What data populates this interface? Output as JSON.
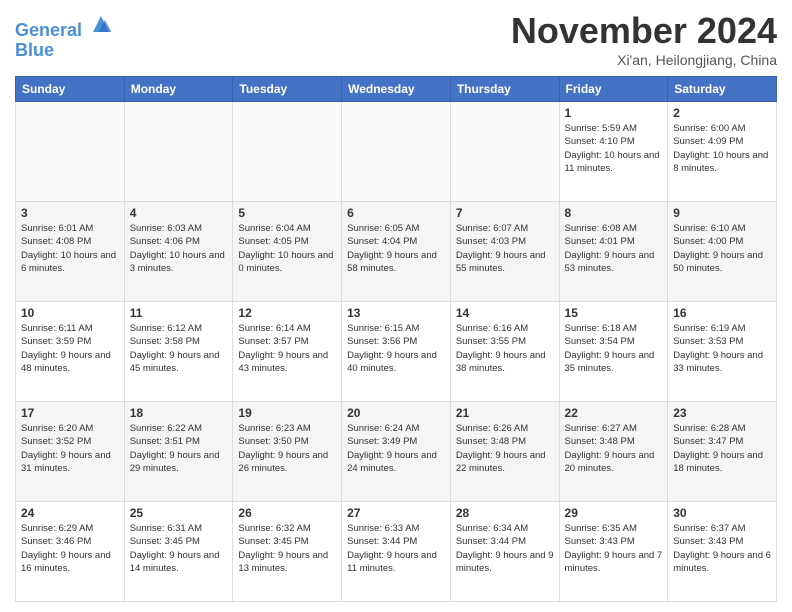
{
  "header": {
    "logo_line1": "General",
    "logo_line2": "Blue",
    "month_title": "November 2024",
    "subtitle": "Xi'an, Heilongjiang, China"
  },
  "days_of_week": [
    "Sunday",
    "Monday",
    "Tuesday",
    "Wednesday",
    "Thursday",
    "Friday",
    "Saturday"
  ],
  "weeks": [
    [
      {
        "day": "",
        "info": ""
      },
      {
        "day": "",
        "info": ""
      },
      {
        "day": "",
        "info": ""
      },
      {
        "day": "",
        "info": ""
      },
      {
        "day": "",
        "info": ""
      },
      {
        "day": "1",
        "info": "Sunrise: 5:59 AM\nSunset: 4:10 PM\nDaylight: 10 hours and 11 minutes."
      },
      {
        "day": "2",
        "info": "Sunrise: 6:00 AM\nSunset: 4:09 PM\nDaylight: 10 hours and 8 minutes."
      }
    ],
    [
      {
        "day": "3",
        "info": "Sunrise: 6:01 AM\nSunset: 4:08 PM\nDaylight: 10 hours and 6 minutes."
      },
      {
        "day": "4",
        "info": "Sunrise: 6:03 AM\nSunset: 4:06 PM\nDaylight: 10 hours and 3 minutes."
      },
      {
        "day": "5",
        "info": "Sunrise: 6:04 AM\nSunset: 4:05 PM\nDaylight: 10 hours and 0 minutes."
      },
      {
        "day": "6",
        "info": "Sunrise: 6:05 AM\nSunset: 4:04 PM\nDaylight: 9 hours and 58 minutes."
      },
      {
        "day": "7",
        "info": "Sunrise: 6:07 AM\nSunset: 4:03 PM\nDaylight: 9 hours and 55 minutes."
      },
      {
        "day": "8",
        "info": "Sunrise: 6:08 AM\nSunset: 4:01 PM\nDaylight: 9 hours and 53 minutes."
      },
      {
        "day": "9",
        "info": "Sunrise: 6:10 AM\nSunset: 4:00 PM\nDaylight: 9 hours and 50 minutes."
      }
    ],
    [
      {
        "day": "10",
        "info": "Sunrise: 6:11 AM\nSunset: 3:59 PM\nDaylight: 9 hours and 48 minutes."
      },
      {
        "day": "11",
        "info": "Sunrise: 6:12 AM\nSunset: 3:58 PM\nDaylight: 9 hours and 45 minutes."
      },
      {
        "day": "12",
        "info": "Sunrise: 6:14 AM\nSunset: 3:57 PM\nDaylight: 9 hours and 43 minutes."
      },
      {
        "day": "13",
        "info": "Sunrise: 6:15 AM\nSunset: 3:56 PM\nDaylight: 9 hours and 40 minutes."
      },
      {
        "day": "14",
        "info": "Sunrise: 6:16 AM\nSunset: 3:55 PM\nDaylight: 9 hours and 38 minutes."
      },
      {
        "day": "15",
        "info": "Sunrise: 6:18 AM\nSunset: 3:54 PM\nDaylight: 9 hours and 35 minutes."
      },
      {
        "day": "16",
        "info": "Sunrise: 6:19 AM\nSunset: 3:53 PM\nDaylight: 9 hours and 33 minutes."
      }
    ],
    [
      {
        "day": "17",
        "info": "Sunrise: 6:20 AM\nSunset: 3:52 PM\nDaylight: 9 hours and 31 minutes."
      },
      {
        "day": "18",
        "info": "Sunrise: 6:22 AM\nSunset: 3:51 PM\nDaylight: 9 hours and 29 minutes."
      },
      {
        "day": "19",
        "info": "Sunrise: 6:23 AM\nSunset: 3:50 PM\nDaylight: 9 hours and 26 minutes."
      },
      {
        "day": "20",
        "info": "Sunrise: 6:24 AM\nSunset: 3:49 PM\nDaylight: 9 hours and 24 minutes."
      },
      {
        "day": "21",
        "info": "Sunrise: 6:26 AM\nSunset: 3:48 PM\nDaylight: 9 hours and 22 minutes."
      },
      {
        "day": "22",
        "info": "Sunrise: 6:27 AM\nSunset: 3:48 PM\nDaylight: 9 hours and 20 minutes."
      },
      {
        "day": "23",
        "info": "Sunrise: 6:28 AM\nSunset: 3:47 PM\nDaylight: 9 hours and 18 minutes."
      }
    ],
    [
      {
        "day": "24",
        "info": "Sunrise: 6:29 AM\nSunset: 3:46 PM\nDaylight: 9 hours and 16 minutes."
      },
      {
        "day": "25",
        "info": "Sunrise: 6:31 AM\nSunset: 3:45 PM\nDaylight: 9 hours and 14 minutes."
      },
      {
        "day": "26",
        "info": "Sunrise: 6:32 AM\nSunset: 3:45 PM\nDaylight: 9 hours and 13 minutes."
      },
      {
        "day": "27",
        "info": "Sunrise: 6:33 AM\nSunset: 3:44 PM\nDaylight: 9 hours and 11 minutes."
      },
      {
        "day": "28",
        "info": "Sunrise: 6:34 AM\nSunset: 3:44 PM\nDaylight: 9 hours and 9 minutes."
      },
      {
        "day": "29",
        "info": "Sunrise: 6:35 AM\nSunset: 3:43 PM\nDaylight: 9 hours and 7 minutes."
      },
      {
        "day": "30",
        "info": "Sunrise: 6:37 AM\nSunset: 3:43 PM\nDaylight: 9 hours and 6 minutes."
      }
    ]
  ]
}
